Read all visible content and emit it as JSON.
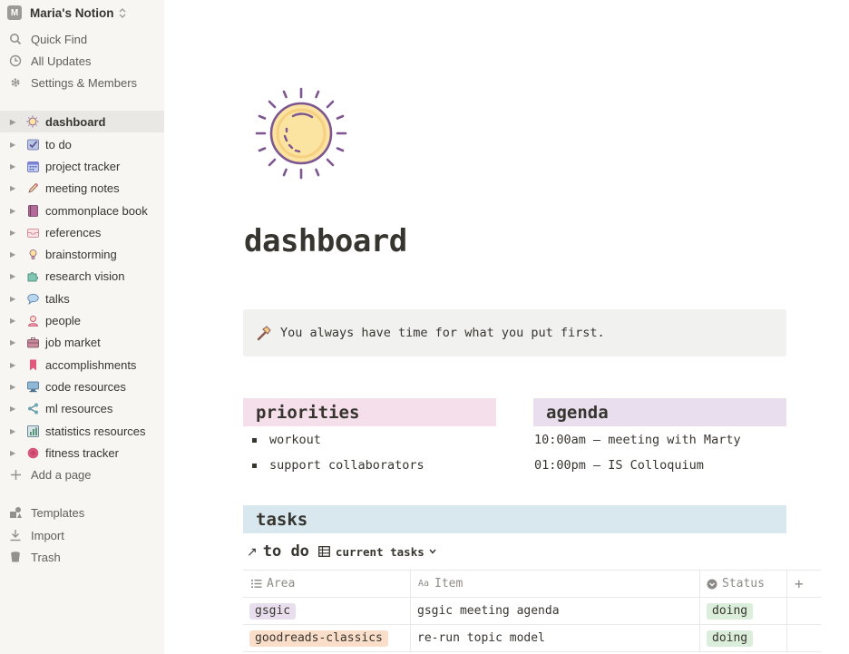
{
  "workspace": {
    "avatar_letter": "M",
    "name": "Maria's Notion",
    "chevron": "⌃"
  },
  "sidebar": {
    "top": [
      {
        "label": "Quick Find",
        "icon": "search-icon"
      },
      {
        "label": "All Updates",
        "icon": "clock-icon"
      },
      {
        "label": "Settings & Members",
        "icon": "gear-icon"
      }
    ],
    "pages": [
      {
        "label": "dashboard",
        "icon": "sun-emoji",
        "active": true
      },
      {
        "label": "to do",
        "icon": "checkbox-emoji"
      },
      {
        "label": "project tracker",
        "icon": "calendar-emoji"
      },
      {
        "label": "meeting notes",
        "icon": "pencil-emoji"
      },
      {
        "label": "commonplace book",
        "icon": "book-emoji"
      },
      {
        "label": "references",
        "icon": "inbox-emoji"
      },
      {
        "label": "brainstorming",
        "icon": "lightbulb-emoji"
      },
      {
        "label": "research vision",
        "icon": "puzzle-emoji"
      },
      {
        "label": "talks",
        "icon": "speech-bubble-emoji"
      },
      {
        "label": "people",
        "icon": "person-emoji"
      },
      {
        "label": "job market",
        "icon": "briefcase-emoji"
      },
      {
        "label": "accomplishments",
        "icon": "bookmark-emoji"
      },
      {
        "label": "code resources",
        "icon": "computer-emoji"
      },
      {
        "label": "ml resources",
        "icon": "share-emoji"
      },
      {
        "label": "statistics resources",
        "icon": "chart-emoji"
      },
      {
        "label": "fitness tracker",
        "icon": "circle-emoji"
      }
    ],
    "add_page": "Add a page",
    "bottom": [
      {
        "label": "Templates",
        "icon": "templates-icon"
      },
      {
        "label": "Import",
        "icon": "import-icon"
      },
      {
        "label": "Trash",
        "icon": "trash-icon"
      }
    ]
  },
  "page": {
    "icon": "sun-icon",
    "title": "dashboard",
    "callout": {
      "icon": "hammer-icon",
      "text": "You always have time for what you put first."
    },
    "priorities": {
      "heading": "priorities",
      "color": "#f4dfeb",
      "items": [
        "workout",
        "support collaborators"
      ]
    },
    "agenda": {
      "heading": "agenda",
      "color": "#e8deee",
      "items": [
        "10:00am — meeting with Marty",
        "01:00pm — IS Colloquium"
      ]
    },
    "tasks": {
      "heading": "tasks",
      "color": "#d9e8ee",
      "db_link_arrow": "↗",
      "db_name": "to do",
      "view_label": "current tasks",
      "columns": [
        {
          "label": "Area",
          "icon": "list-icon"
        },
        {
          "label": "Item",
          "icon": "text-aa-icon"
        },
        {
          "label": "Status",
          "icon": "select-icon"
        }
      ],
      "add_column": "+",
      "rows": [
        {
          "area": "gsgic",
          "area_color": "#e8deee",
          "item": "gsgic meeting agenda",
          "status": "doing",
          "status_color": "#dbeddb"
        },
        {
          "area": "goodreads-classics",
          "area_color": "#fadec9",
          "item": "re-run topic model",
          "status": "doing",
          "status_color": "#dbeddb"
        }
      ]
    }
  }
}
